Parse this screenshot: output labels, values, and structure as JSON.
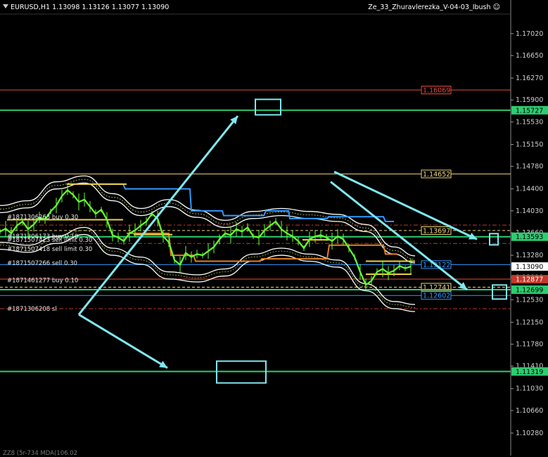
{
  "header": {
    "symbol_info": "EURUSD,H1  1.13098 1.13126 1.13077 1.13090",
    "indicator_name": "Ze_33_Zhuravlerezka_V-04-03_Ibush",
    "smiley_icon": "smiley-face-icon"
  },
  "footer": {
    "text": "ZZ8 (5r-734 MDA(106.02"
  },
  "colors": {
    "background": "#000000",
    "price_line_green": "#66ff33",
    "level_green": "#2ecc71",
    "arrow_cyan": "#7fe8f0",
    "level_red": "#c0392b",
    "level_yellow": "#f0d77b",
    "envelope_blue": "#3399ff",
    "envelope_orange": "#e67e22",
    "band_white": "#ffffff"
  },
  "chart_data": {
    "type": "line",
    "symbol": "EURUSD",
    "timeframe": "H1",
    "ylim": [
      1.099,
      1.1735
    ],
    "y_ticks": [
      "1.17020",
      "1.16650",
      "1.16270",
      "1.15900",
      "1.15530",
      "1.15150",
      "1.14780",
      "1.14400",
      "1.14030",
      "1.13660",
      "1.13280",
      "1.12910",
      "1.12530",
      "1.12150",
      "1.11780",
      "1.11410",
      "1.11030",
      "1.10660",
      "1.10280"
    ],
    "current_price": "1.13090",
    "levels": [
      {
        "label": "1.16069",
        "price": 1.16069,
        "color": "#e74c3c",
        "style": "solid"
      },
      {
        "label": "1.15727",
        "price": 1.15727,
        "color": "#2ecc71",
        "style": "solid",
        "badge": "green"
      },
      {
        "label": "1.14652",
        "price": 1.14652,
        "color": "#f0d77b",
        "style": "solid"
      },
      {
        "label": "1.13697",
        "price": 1.13697,
        "color": "#f0d77b",
        "style": "dash"
      },
      {
        "label": "1.13593",
        "price": 1.13593,
        "color": "#2ecc71",
        "style": "solid",
        "badge": "green"
      },
      {
        "label": "1.13122",
        "price": 1.13122,
        "color": "#3399ff",
        "style": "solid"
      },
      {
        "label": "1.12877",
        "price": 1.12877,
        "color": "#e74c3c",
        "style": "solid",
        "badge": "red"
      },
      {
        "label": "1.12741",
        "price": 1.12741,
        "color": "#f0d77b",
        "style": "dash"
      },
      {
        "label": "1.12699",
        "price": 1.12699,
        "color": "#2ecc71",
        "style": "solid",
        "badge": "green"
      },
      {
        "label": "1.12602",
        "price": 1.12602,
        "color": "#3399ff",
        "style": "solid"
      },
      {
        "label": "1.11319",
        "price": 1.11319,
        "color": "#2ecc71",
        "style": "solid",
        "badge": "green"
      }
    ],
    "order_labels": [
      {
        "text": "#1871306263 buy 0.30",
        "price": 1.1393
      },
      {
        "text": "#1871306173 buy 0.10",
        "price": 1.136
      },
      {
        "text": "#1871507423 sell limit 0.30",
        "price": 1.1354
      },
      {
        "text": "#1871507418 sell limit 0.30",
        "price": 1.1339
      },
      {
        "text": "#1871507266 sell 0.30",
        "price": 1.1315
      },
      {
        "text": "#1871461277 buy 0.10",
        "price": 1.1286
      },
      {
        "text": "#1871306208 sl",
        "price": 1.1238
      }
    ],
    "red_dash_levels": [
      1.1379,
      1.1348,
      1.1238
    ],
    "price_series": {
      "name": "EURUSD H1 close",
      "x": [
        0,
        8,
        16,
        24,
        32,
        40,
        48,
        56,
        64,
        72,
        80,
        88,
        96,
        104,
        112,
        120,
        128,
        136,
        144,
        152,
        160,
        168,
        176,
        184,
        192,
        200,
        208,
        216,
        224,
        232,
        240,
        248,
        256,
        264,
        272,
        280,
        288,
        296,
        304,
        312,
        320,
        328,
        336,
        344,
        352,
        360,
        368,
        376,
        384,
        392,
        400,
        408,
        416,
        424,
        432,
        440,
        448,
        456,
        464,
        472,
        480,
        488,
        496,
        504,
        512,
        520,
        528,
        536,
        544,
        552,
        560,
        568,
        576,
        584
      ],
      "y": [
        1.1368,
        1.1373,
        1.1365,
        1.1378,
        1.1385,
        1.1372,
        1.138,
        1.1392,
        1.1388,
        1.1402,
        1.1412,
        1.1428,
        1.1438,
        1.143,
        1.1418,
        1.1422,
        1.141,
        1.1398,
        1.1405,
        1.1388,
        1.1362,
        1.1358,
        1.1352,
        1.1365,
        1.137,
        1.1378,
        1.1385,
        1.1398,
        1.139,
        1.136,
        1.135,
        1.132,
        1.1312,
        1.1332,
        1.1325,
        1.133,
        1.1328,
        1.1335,
        1.1342,
        1.1355,
        1.1365,
        1.1362,
        1.1372,
        1.1368,
        1.1375,
        1.136,
        1.1358,
        1.137,
        1.1378,
        1.1385,
        1.1372,
        1.1365,
        1.136,
        1.1352,
        1.134,
        1.1355,
        1.136,
        1.1362,
        1.1358,
        1.1352,
        1.136,
        1.1355,
        1.134,
        1.1325,
        1.13,
        1.1278,
        1.1285,
        1.13,
        1.1305,
        1.1298,
        1.1302,
        1.131,
        1.1306,
        1.1309
      ]
    },
    "upper_band": {
      "name": "upper envelope",
      "x": [
        0,
        40,
        80,
        120,
        160,
        200,
        240,
        280,
        320,
        360,
        400,
        440,
        480,
        520,
        560,
        590
      ],
      "y": [
        1.14,
        1.1408,
        1.144,
        1.145,
        1.142,
        1.1395,
        1.141,
        1.1392,
        1.1375,
        1.139,
        1.1395,
        1.139,
        1.1385,
        1.1368,
        1.133,
        1.1315
      ]
    },
    "lower_band": {
      "name": "lower envelope",
      "x": [
        0,
        40,
        80,
        120,
        160,
        200,
        240,
        280,
        320,
        360,
        400,
        440,
        480,
        520,
        560,
        590
      ],
      "y": [
        1.135,
        1.1345,
        1.136,
        1.1375,
        1.134,
        1.1325,
        1.13,
        1.1295,
        1.1305,
        1.133,
        1.134,
        1.133,
        1.132,
        1.128,
        1.125,
        1.1245
      ]
    },
    "blue_steps": {
      "x": [
        95,
        175,
        178,
        270,
        272,
        316,
        318,
        375,
        378,
        410,
        412,
        465,
        467,
        545,
        548,
        560
      ],
      "y": [
        1.1448,
        1.1448,
        1.144,
        1.144,
        1.1403,
        1.1403,
        1.1395,
        1.1395,
        1.1403,
        1.1403,
        1.139,
        1.139,
        1.1393,
        1.1393,
        1.1385,
        1.1385
      ]
    },
    "orange_steps": {
      "x": [
        180,
        240,
        243,
        275,
        278,
        370,
        372,
        465,
        468,
        545,
        548,
        565
      ],
      "y": [
        1.1365,
        1.1365,
        1.1328,
        1.1328,
        1.1318,
        1.1318,
        1.1322,
        1.1322,
        1.1345,
        1.1345,
        1.133,
        1.133
      ]
    },
    "annotations": {
      "arrows": [
        {
          "from": [
            1.1228,
            112
          ],
          "to": [
            1.1563,
            338
          ]
        },
        {
          "from": [
            1.1228,
            112
          ],
          "to": [
            1.1138,
            238
          ]
        },
        {
          "from": [
            1.1469,
            475
          ],
          "to": [
            1.1355,
            678
          ]
        },
        {
          "from": [
            1.1452,
            470
          ],
          "to": [
            1.127,
            664
          ]
        }
      ],
      "boxes": [
        {
          "center_x": 381,
          "price": 1.1578
        },
        {
          "center_x": 343,
          "price": 1.1131
        },
        {
          "center_x": 702,
          "price": 1.1355
        },
        {
          "center_x": 710,
          "price": 1.1266
        }
      ]
    },
    "grid": false,
    "legend": "none"
  }
}
